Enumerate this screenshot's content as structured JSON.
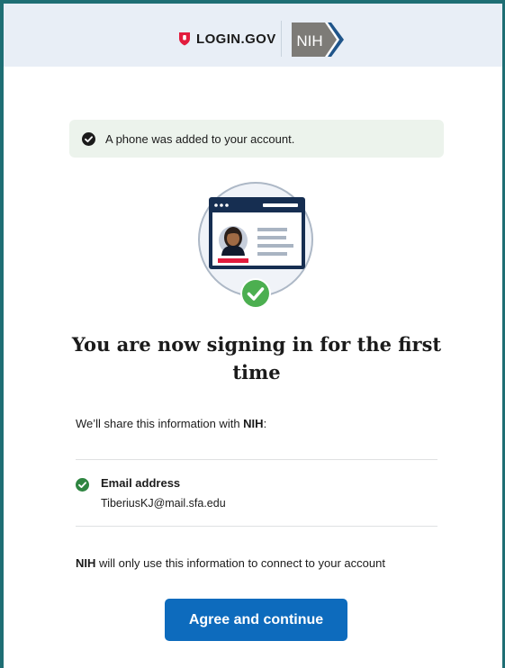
{
  "header": {
    "brand_text": "LOGIN.GOV",
    "brand_icon": "shield-icon",
    "partner_logo_text": "NIH"
  },
  "alert": {
    "icon": "check-circle-icon",
    "text": "A phone was added to your account."
  },
  "illustration": {
    "icon": "id-card-check-icon"
  },
  "title": "You are now signing in for the first time",
  "share": {
    "prefix": "We’ll share this information with ",
    "partner": "NIH",
    "suffix": ":"
  },
  "attributes": [
    {
      "icon": "check-circle-icon",
      "label": "Email address",
      "value": "TiberiusKJ@mail.sfa.edu"
    }
  ],
  "usage": {
    "partner": "NIH",
    "text": " will only use this information to connect to your account"
  },
  "actions": {
    "primary_label": "Agree and continue"
  },
  "colors": {
    "frame_border": "#1e6e74",
    "header_bg": "#e8eef6",
    "brand_red": "#e21c3d",
    "alert_bg": "#ecf3ec",
    "success_green": "#2e8540",
    "primary_blue": "#0d6bbd",
    "card_navy": "#162e51",
    "nih_gray": "#7d7b77",
    "nih_blue": "#20558a"
  }
}
